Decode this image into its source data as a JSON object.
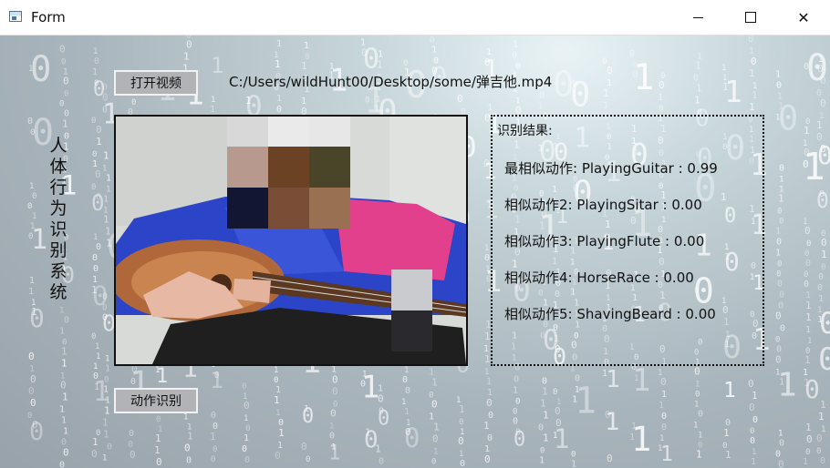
{
  "window": {
    "title": "Form",
    "minimize_label": "—",
    "maximize_label": "□",
    "close_label": "✕"
  },
  "sidebar": {
    "title": "人体行为识别系统"
  },
  "controls": {
    "open_video_label": "打开视频",
    "file_path": "C:/Users/wildHunt00/Desktop/some/弹吉他.mp4",
    "recognize_label": "动作识别"
  },
  "results": {
    "title": "识别结果:",
    "lines": [
      "最相似动作:  PlayingGuitar : 0.99",
      "相似动作2:  PlayingSitar : 0.00",
      "相似动作3:  PlayingFlute : 0.00",
      "相似动作4:  HorseRace : 0.00",
      "相似动作5:  ShavingBeard : 0.00"
    ]
  },
  "icons": {
    "app": "form-app-icon",
    "video": "video-frame-guitar-player"
  },
  "colors": {
    "background_light": "#e9f3f6",
    "background_dark": "#98a2aa",
    "button_bg": "#b1b3b6",
    "button_border": "#f2f2f2"
  }
}
